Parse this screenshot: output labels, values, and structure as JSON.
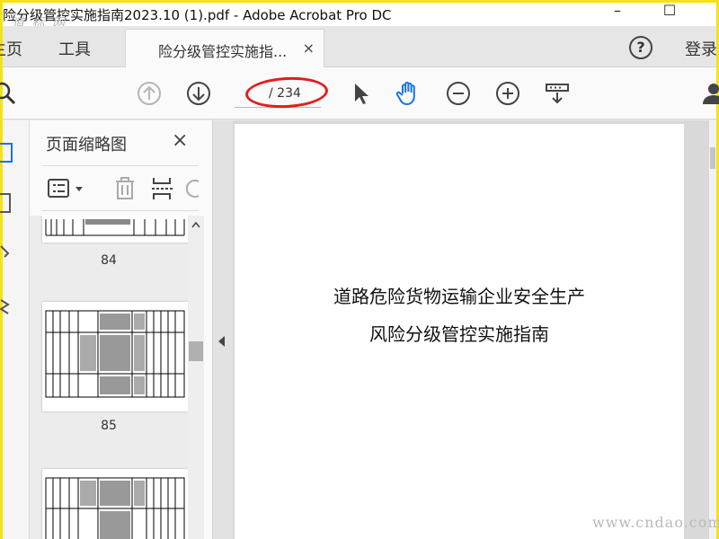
{
  "window": {
    "title": "险分级管控实施指南2023.10 (1).pdf - Adobe Acrobat Pro DC",
    "minimize": "–",
    "maximize": "☐"
  },
  "watermark_top": "道 标 网",
  "tabs": {
    "home": "主页",
    "tools": "工具",
    "document": "险分级管控实施指...",
    "close": "×",
    "help": "?",
    "login": "登录"
  },
  "toolbar": {
    "page_total": "/ 234",
    "icons": [
      "search-icon",
      "page-up-icon",
      "page-down-icon",
      "select-arrow-icon",
      "hand-tool-icon",
      "zoom-out-icon",
      "zoom-in-icon",
      "fit-page-icon",
      "user-icon"
    ]
  },
  "thumbnail_panel": {
    "title": "页面缩略图",
    "close": "×",
    "pages": [
      {
        "label": "84"
      },
      {
        "label": "85"
      }
    ]
  },
  "document": {
    "title_line1": "道路危险货物运输企业安全生产",
    "title_line2": "风险分级管控实施指南"
  },
  "watermark_bottom": "www.cndao.com",
  "colors": {
    "highlight_ring": "#e21d1d",
    "accent_blue": "#1a73e8",
    "frame": "#f5e11a"
  }
}
